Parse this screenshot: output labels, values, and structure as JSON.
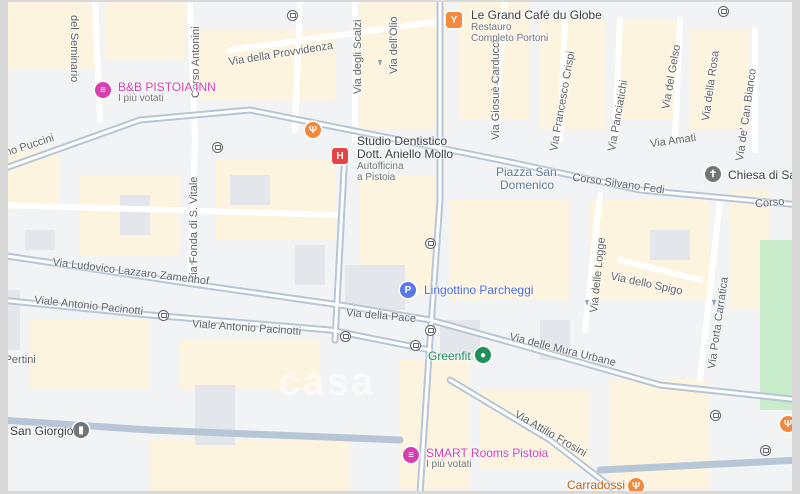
{
  "map": {
    "streets": {
      "seminario": "del Seminario",
      "antonini": "Corso Antonini",
      "provvidenza": "Via della Provvidenza",
      "scalzi": "Via degli Scalzi",
      "dellolio": "Via dell'Olio",
      "puccini": "Piazza Giacomo Puccini",
      "fonda": "Via Fonda di S. Vitale",
      "carducci": "Via Giosuè Carducci",
      "crispi": "Via Francesco Crispi",
      "panciatichi": "Via Panciatichi",
      "gelso": "Via del Gelso",
      "rosa": "Via della Rosa",
      "canbianco": "Via de' Can Bianco",
      "amati": "Via Amati",
      "fedi": "Corso Silvano Fedi",
      "corsoright": "Corso",
      "zamenhof": "Via Ludovico Lazzaro Zamenhof",
      "pacinotti1": "Viale Antonio Pacinotti",
      "pacinotti2": "Viale Antonio Pacinotti",
      "pace": "Via della Pace",
      "logge": "Via delle Logge",
      "spigo": "Via dello Spigo",
      "carratica": "Via Porta Carratica",
      "muraurbane": "Via delle Mura Urbane",
      "frosini": "Via Attilio Frosini",
      "pertini": "Piazza Sandro Pertini"
    },
    "places": {
      "grandcafe": {
        "name": "Le Grand Café du Globe",
        "sub1": "Restauro",
        "sub2": "Completo Portoni"
      },
      "bbinn": {
        "name": "B&B PISTOIA INN",
        "sub": "I più votati"
      },
      "studio": {
        "name1": "Studio Dentistico",
        "name2": "Dott. Aniello Mollo",
        "sub1": "Autofficina",
        "sub2": "a Pistoia"
      },
      "piazza": {
        "name1": "Piazza San",
        "name2": "Domenico"
      },
      "chiesa": {
        "name": "Chiesa di Sa"
      },
      "parking": {
        "name": "Lingottino Parcheggi"
      },
      "greenfit": {
        "name": "Greenfit"
      },
      "sangiorgio": {
        "name": "San Giorgio"
      },
      "smart": {
        "name": "SMART Rooms Pistoia",
        "sub": "I più votati"
      },
      "carradossi": {
        "name": "Carradossi"
      }
    },
    "watermark": "casa",
    "icons": {
      "bar": "cocktail-icon",
      "hotel": "bed-icon",
      "restaurant": "fork-knife-icon",
      "hospital": "hospital-icon",
      "parking": "parking-icon",
      "gym": "gym-icon",
      "church": "cross-icon",
      "bus": "bus-stop-icon"
    },
    "colors": {
      "pink": "#d63fb0",
      "orange": "#f2893b",
      "red": "#e64545",
      "blue": "#5b78e8",
      "green": "#1e8e5a",
      "road": "#ffffff",
      "major_road": "#aebfd3",
      "block": "#fdf4e0",
      "park": "#c8ebc9"
    }
  }
}
